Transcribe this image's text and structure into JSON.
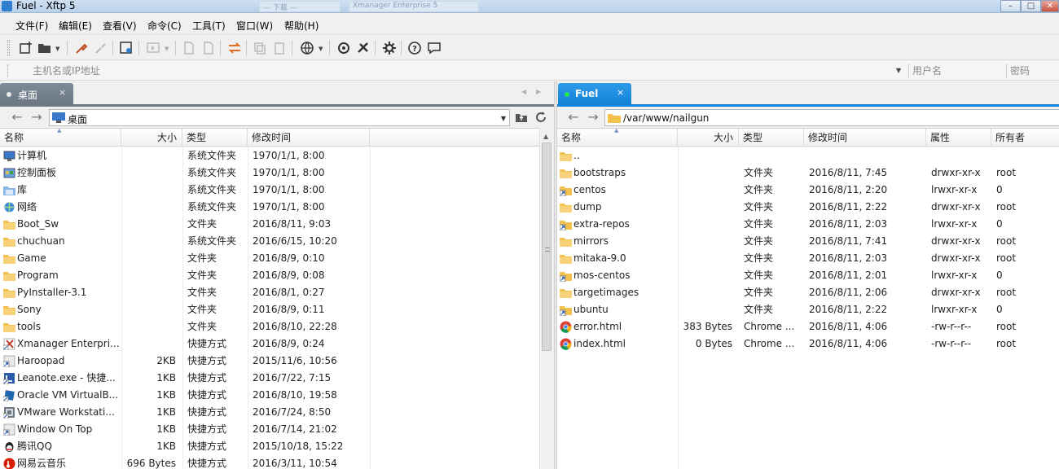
{
  "window": {
    "title": "Fuel    - Xftp 5",
    "background_tab_1": "— 下载 —",
    "background_tab_2": "Xmanager Enterprise 5",
    "minimize": "–",
    "maximize": "□",
    "close": "✕"
  },
  "menu": [
    "文件(F)",
    "编辑(E)",
    "查看(V)",
    "命令(C)",
    "工具(T)",
    "窗口(W)",
    "帮助(H)"
  ],
  "toolbar": {
    "icons": [
      "new-session-icon",
      "open-folder-icon",
      "connect-icon",
      "disconnect-icon",
      "session-properties-icon",
      "transfer-icon",
      "copy-icon",
      "paste-icon",
      "sync-icon",
      "globe-icon",
      "xshell-icon",
      "xmanager-icon",
      "settings-icon",
      "help-icon",
      "feedback-icon"
    ]
  },
  "address_bar": {
    "host_placeholder": "主机名或IP地址",
    "user_placeholder": "用户名",
    "password_placeholder": "密码"
  },
  "colors": {
    "left_tab": "#6c7886",
    "right_tab": "#1382d8",
    "folder": "#f2c14e",
    "connected_dot": "#2ee25a"
  },
  "left_pane": {
    "tab_label": "桌面",
    "tab_close": "×",
    "path": "桌面",
    "columns": {
      "name": "名称",
      "size": "大小",
      "type": "类型",
      "modified": "修改时间"
    },
    "rows": [
      {
        "name": "计算机",
        "size": "",
        "type": "系统文件夹",
        "modified": "1970/1/1, 8:00",
        "icon": "computer-icon"
      },
      {
        "name": "控制面板",
        "size": "",
        "type": "系统文件夹",
        "modified": "1970/1/1, 8:00",
        "icon": "control-panel-icon"
      },
      {
        "name": "库",
        "size": "",
        "type": "系统文件夹",
        "modified": "1970/1/1, 8:00",
        "icon": "library-icon"
      },
      {
        "name": "网络",
        "size": "",
        "type": "系统文件夹",
        "modified": "1970/1/1, 8:00",
        "icon": "network-icon"
      },
      {
        "name": "Boot_Sw",
        "size": "",
        "type": "文件夹",
        "modified": "2016/8/11, 9:03",
        "icon": "folder-icon"
      },
      {
        "name": "chuchuan",
        "size": "",
        "type": "系统文件夹",
        "modified": "2016/6/15, 10:20",
        "icon": "folder-icon"
      },
      {
        "name": "Game",
        "size": "",
        "type": "文件夹",
        "modified": "2016/8/9, 0:10",
        "icon": "folder-icon"
      },
      {
        "name": "Program",
        "size": "",
        "type": "文件夹",
        "modified": "2016/8/9, 0:08",
        "icon": "folder-icon"
      },
      {
        "name": "PyInstaller-3.1",
        "size": "",
        "type": "文件夹",
        "modified": "2016/8/1, 0:27",
        "icon": "folder-icon"
      },
      {
        "name": "Sony",
        "size": "",
        "type": "文件夹",
        "modified": "2016/8/9, 0:11",
        "icon": "folder-icon"
      },
      {
        "name": "tools",
        "size": "",
        "type": "文件夹",
        "modified": "2016/8/10, 22:28",
        "icon": "folder-icon"
      },
      {
        "name": "Xmanager Enterpri...",
        "size": "",
        "type": "快捷方式",
        "modified": "2016/8/9, 0:24",
        "icon": "xmanager-icon"
      },
      {
        "name": "Haroopad",
        "size": "2KB",
        "type": "快捷方式",
        "modified": "2015/11/6, 10:56",
        "icon": "shortcut-icon"
      },
      {
        "name": "Leanote.exe - 快捷...",
        "size": "1KB",
        "type": "快捷方式",
        "modified": "2016/7/22, 7:15",
        "icon": "leanote-icon"
      },
      {
        "name": "Oracle VM VirtualB...",
        "size": "1KB",
        "type": "快捷方式",
        "modified": "2016/8/10, 19:58",
        "icon": "virtualbox-icon"
      },
      {
        "name": "VMware Workstati...",
        "size": "1KB",
        "type": "快捷方式",
        "modified": "2016/7/24, 8:50",
        "icon": "vmware-icon"
      },
      {
        "name": "Window On Top",
        "size": "1KB",
        "type": "快捷方式",
        "modified": "2016/7/14, 21:02",
        "icon": "shortcut-icon"
      },
      {
        "name": "腾讯QQ",
        "size": "1KB",
        "type": "快捷方式",
        "modified": "2015/10/18, 15:22",
        "icon": "qq-icon"
      },
      {
        "name": "网易云音乐",
        "size": "696 Bytes",
        "type": "快捷方式",
        "modified": "2016/3/11, 10:54",
        "icon": "music-icon"
      }
    ]
  },
  "right_pane": {
    "tab_label": "Fuel",
    "tab_close": "×",
    "path": "/var/www/nailgun",
    "columns": {
      "name": "名称",
      "size": "大小",
      "type": "类型",
      "modified": "修改时间",
      "attributes": "属性",
      "owner": "所有者"
    },
    "rows": [
      {
        "name": "..",
        "size": "",
        "type": "",
        "modified": "",
        "attributes": "",
        "owner": "",
        "icon": "folder-icon"
      },
      {
        "name": "bootstraps",
        "size": "",
        "type": "文件夹",
        "modified": "2016/8/11, 7:45",
        "attributes": "drwxr-xr-x",
        "owner": "root",
        "icon": "folder-icon"
      },
      {
        "name": "centos",
        "size": "",
        "type": "文件夹",
        "modified": "2016/8/11, 2:20",
        "attributes": "lrwxr-xr-x",
        "owner": "0",
        "icon": "folder-link-icon"
      },
      {
        "name": "dump",
        "size": "",
        "type": "文件夹",
        "modified": "2016/8/11, 2:22",
        "attributes": "drwxr-xr-x",
        "owner": "root",
        "icon": "folder-icon"
      },
      {
        "name": "extra-repos",
        "size": "",
        "type": "文件夹",
        "modified": "2016/8/11, 2:03",
        "attributes": "lrwxr-xr-x",
        "owner": "0",
        "icon": "folder-link-icon"
      },
      {
        "name": "mirrors",
        "size": "",
        "type": "文件夹",
        "modified": "2016/8/11, 7:41",
        "attributes": "drwxr-xr-x",
        "owner": "root",
        "icon": "folder-icon"
      },
      {
        "name": "mitaka-9.0",
        "size": "",
        "type": "文件夹",
        "modified": "2016/8/11, 2:03",
        "attributes": "drwxr-xr-x",
        "owner": "root",
        "icon": "folder-icon"
      },
      {
        "name": "mos-centos",
        "size": "",
        "type": "文件夹",
        "modified": "2016/8/11, 2:01",
        "attributes": "lrwxr-xr-x",
        "owner": "0",
        "icon": "folder-link-icon"
      },
      {
        "name": "targetimages",
        "size": "",
        "type": "文件夹",
        "modified": "2016/8/11, 2:06",
        "attributes": "drwxr-xr-x",
        "owner": "root",
        "icon": "folder-icon"
      },
      {
        "name": "ubuntu",
        "size": "",
        "type": "文件夹",
        "modified": "2016/8/11, 2:22",
        "attributes": "lrwxr-xr-x",
        "owner": "0",
        "icon": "folder-link-icon"
      },
      {
        "name": "error.html",
        "size": "383 Bytes",
        "type": "Chrome ...",
        "modified": "2016/8/11, 4:06",
        "attributes": "-rw-r--r--",
        "owner": "root",
        "icon": "chrome-icon"
      },
      {
        "name": "index.html",
        "size": "0 Bytes",
        "type": "Chrome ...",
        "modified": "2016/8/11, 4:06",
        "attributes": "-rw-r--r--",
        "owner": "root",
        "icon": "chrome-icon"
      }
    ]
  }
}
